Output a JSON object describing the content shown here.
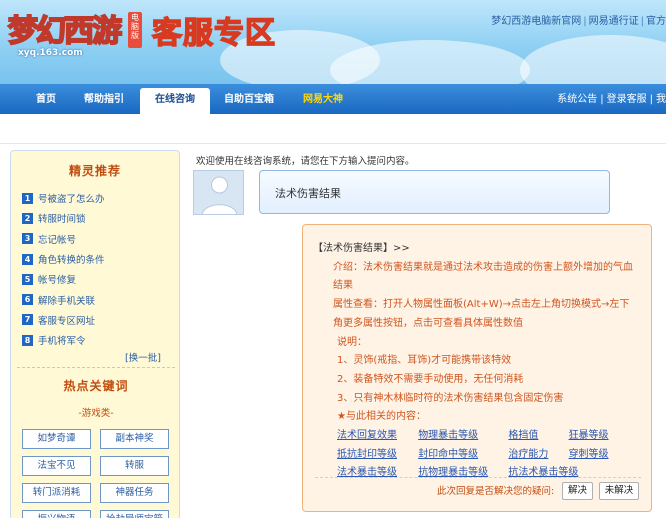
{
  "header": {
    "logo_text": "梦幻西游",
    "logo_tag": "电脑版",
    "logo_domain": "xyq.163.com",
    "site_title": "客服专区",
    "top_links": [
      "梦幻西游电脑新官网",
      "网易通行证",
      "官方"
    ]
  },
  "nav": {
    "items": [
      "首页",
      "帮助指引",
      "在线咨询",
      "自助百宝箱",
      "网易大神"
    ],
    "active": "在线咨询",
    "right_links": [
      "系统公告",
      "登录客服",
      "我"
    ]
  },
  "sidebar": {
    "title": "精灵推荐",
    "items": [
      {
        "num": "1",
        "label": "号被盗了怎么办"
      },
      {
        "num": "2",
        "label": "转服时间锁"
      },
      {
        "num": "3",
        "label": "忘记帐号"
      },
      {
        "num": "4",
        "label": "角色转换的条件"
      },
      {
        "num": "5",
        "label": "帐号修复"
      },
      {
        "num": "6",
        "label": "解除手机关联"
      },
      {
        "num": "7",
        "label": "客服专区网址"
      },
      {
        "num": "8",
        "label": "手机将军令"
      }
    ],
    "more_link": "[换一批]",
    "hot_title": "热点关键词",
    "game_category": "-游戏类-",
    "keywords": [
      "如梦奇谭",
      "副本神奖",
      "法宝不见",
      "转服",
      "转门派消耗",
      "神器任务",
      "振兴物语",
      "抢劫导师宝箱"
    ]
  },
  "main": {
    "welcome": "欢迎使用在线咨询系统，请您在下方输入提问内容。",
    "question": "法术伤害结果",
    "answer": {
      "head": "【法术伤害结果】>>",
      "intro": "介绍：法术伤害结果就是通过法术攻击造成的伤害上额外增加的气血结果",
      "check": "属性查看：打开人物属性面板(Alt+W)→点击左上角切换模式→左下角更多属性按钮，点击可查看具体属性数值",
      "note_title": "说明：",
      "notes": [
        "1、灵饰(戒指、耳饰)才可能携带该特效",
        "2、装备特效不需要手动使用，无任何消耗",
        "3、只有神木林临时符的法术伤害结果包含固定伤害"
      ],
      "related_title": "★与此相关的内容：",
      "related": [
        [
          "法术回复效果",
          "物理暴击等级",
          "格挡值",
          "狂暴等级"
        ],
        [
          "抵抗封印等级",
          "封印命中等级",
          "治疗能力",
          "穿刺等级"
        ],
        [
          "法术暴击等级",
          "抗物理暴击等级",
          "抗法术暴击等级"
        ]
      ],
      "feedback": "此次回复是否解决您的疑问:",
      "btn_yes": "解决",
      "btn_no": "未解决"
    }
  },
  "colors": {
    "nav_blue": "#1a68c2",
    "accent_orange": "#d0561e",
    "link_blue": "#2b58b0"
  }
}
